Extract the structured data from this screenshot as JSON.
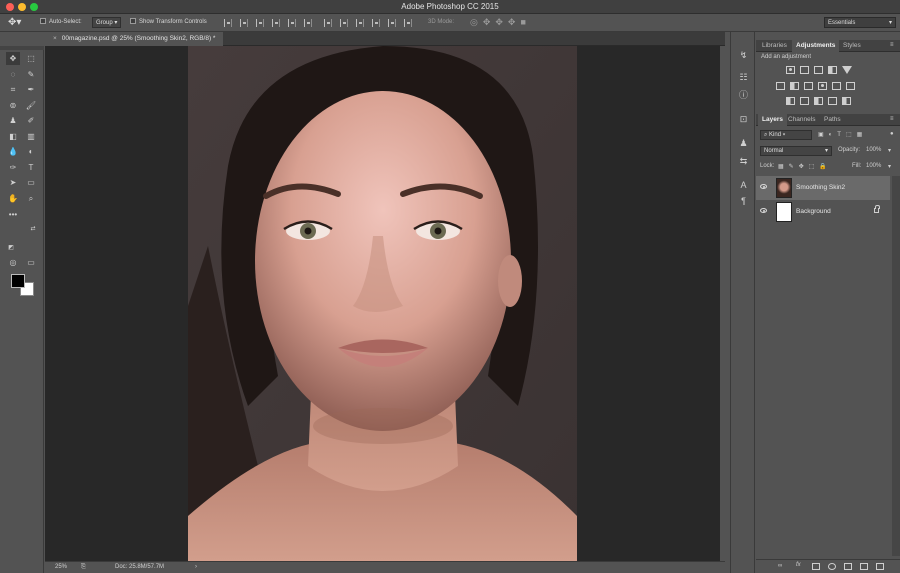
{
  "window": {
    "title": "Adobe Photoshop CC 2015"
  },
  "options": {
    "auto_select_label": "Auto-Select:",
    "auto_select_target": "Group",
    "transform_label": "Show Transform Controls",
    "mode_3d_label": "3D Mode:",
    "workspace": "Essentials"
  },
  "document": {
    "tab_title": "00magazine.psd @ 25% (Smoothing Skin2, RGB/8) *",
    "close_glyph": "×"
  },
  "status": {
    "zoom": "25%",
    "doc_size": "Doc: 25.8M/57.7M"
  },
  "adjustments_panel": {
    "tabs": [
      "Libraries",
      "Adjustments",
      "Styles"
    ],
    "active_tab": "Adjustments",
    "hint": "Add an adjustment"
  },
  "layers_panel": {
    "tabs": [
      "Layers",
      "Channels",
      "Paths"
    ],
    "active_tab": "Layers",
    "filter_kind": "Kind",
    "blend_mode": "Normal",
    "opacity_label": "Opacity:",
    "opacity_value": "100%",
    "lock_label": "Lock:",
    "fill_label": "Fill:",
    "fill_value": "100%",
    "layers": [
      {
        "name": "Smoothing Skin2",
        "selected": true
      },
      {
        "name": "Background",
        "selected": false,
        "locked": true
      }
    ]
  },
  "colors": {
    "foreground": "#000000",
    "background": "#ffffff",
    "accent": "#6a6a6a"
  },
  "icons": {
    "move": "move-icon",
    "marquee": "marquee-icon",
    "lasso": "lasso-icon",
    "brush": "brush-icon",
    "eye": "eye-icon",
    "lock": "lock-icon"
  }
}
